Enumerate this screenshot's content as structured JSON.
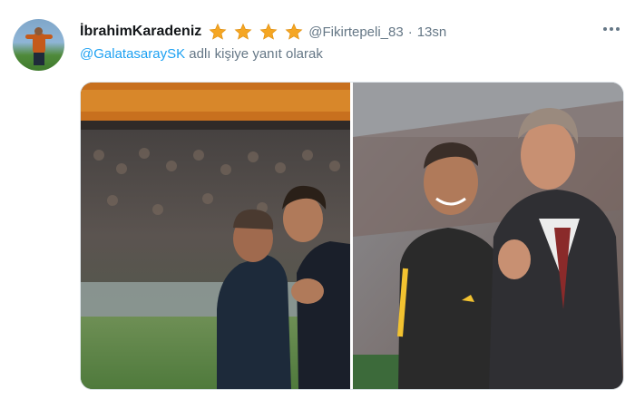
{
  "tweet": {
    "display_name": "İbrahimKaradeniz",
    "star_count": 4,
    "handle": "@Fikirtepeli_83",
    "separator": "·",
    "time": "13sn",
    "reply_to": "@GalatasaraySK",
    "reply_suffix": " adlı kişiye yanıt olarak"
  },
  "icons": {
    "avatar": "profile-avatar",
    "star": "star-icon",
    "more": "more-options-icon"
  },
  "colors": {
    "name": "#14171a",
    "secondary": "#657786",
    "mention": "#1da1f2",
    "star": "#f5a623"
  }
}
